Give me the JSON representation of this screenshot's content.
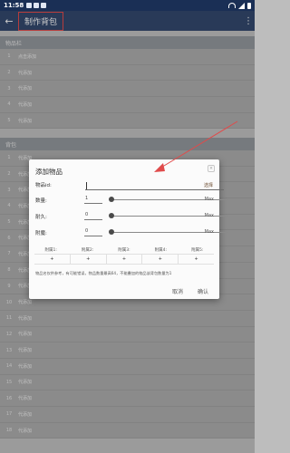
{
  "status": {
    "time": "11:58"
  },
  "appbar": {
    "title": "制作背包",
    "back_icon": "arrow-left-icon",
    "more_icon": "more-vert-icon"
  },
  "items_section": {
    "header": "物品栏",
    "rows": [
      {
        "num": "1",
        "text": "点击添加"
      },
      {
        "num": "2",
        "text": "代添加"
      },
      {
        "num": "3",
        "text": "代添加"
      },
      {
        "num": "4",
        "text": "代添加"
      },
      {
        "num": "5",
        "text": "代添加"
      }
    ]
  },
  "bag_section": {
    "header": "背包",
    "rows": [
      {
        "num": "1",
        "text": "代添加"
      },
      {
        "num": "2",
        "text": "代添加"
      },
      {
        "num": "3",
        "text": "代添加"
      },
      {
        "num": "4",
        "text": "代添加"
      },
      {
        "num": "5",
        "text": "代添加"
      },
      {
        "num": "6",
        "text": "代添加"
      },
      {
        "num": "7",
        "text": "代添加"
      },
      {
        "num": "8",
        "text": "代添加"
      },
      {
        "num": "9",
        "text": "代添加"
      },
      {
        "num": "10",
        "text": "代添加"
      },
      {
        "num": "11",
        "text": "代添加"
      },
      {
        "num": "12",
        "text": "代添加"
      },
      {
        "num": "13",
        "text": "代添加"
      },
      {
        "num": "14",
        "text": "代添加"
      },
      {
        "num": "15",
        "text": "代添加"
      },
      {
        "num": "16",
        "text": "代添加"
      },
      {
        "num": "17",
        "text": "代添加"
      },
      {
        "num": "18",
        "text": "代添加"
      }
    ]
  },
  "dialog": {
    "title": "添加物品",
    "close_icon": "close-icon",
    "item_id_label": "物品id:",
    "item_id_value": "",
    "select_label": "选择",
    "quantity": {
      "label": "数量:",
      "value": "1",
      "max": "Max",
      "level": 0
    },
    "durability": {
      "label": "耐久:",
      "value": "0",
      "max": "Max",
      "level": 0
    },
    "enchant": {
      "label": "附魔:",
      "value": "0",
      "max": "Max",
      "level": 0
    },
    "attr_labels": [
      "附属1:",
      "附属2:",
      "附属3:",
      "附属4:",
      "附属5:"
    ],
    "attr_values": [
      "+",
      "+",
      "+",
      "+",
      "+"
    ],
    "hint": "物品名仅供参考，有可能错误，物品数量最高64，不能叠加的物品该背包数量为1",
    "cancel_label": "取消",
    "ok_label": "确认"
  },
  "colors": {
    "appbar": "#1f3760",
    "highlight": "#e23a3a",
    "arrow": "#e04b4b"
  }
}
